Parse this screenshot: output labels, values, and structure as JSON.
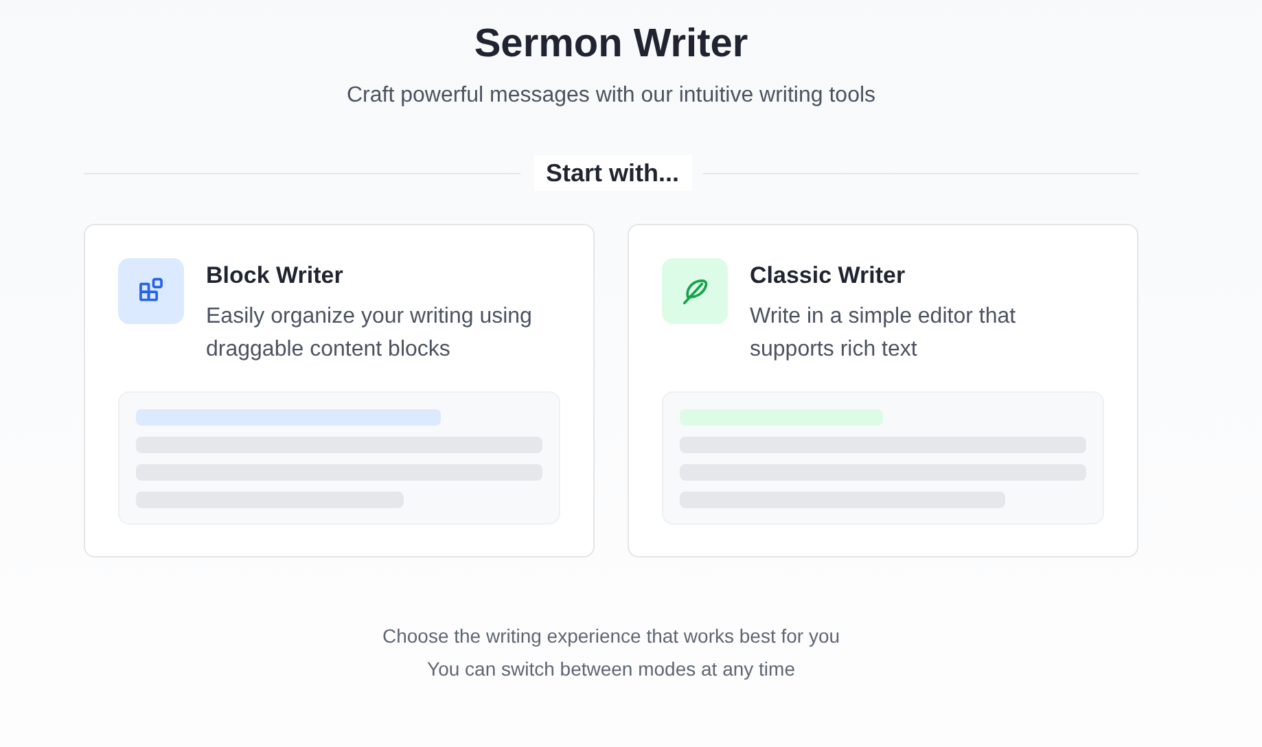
{
  "header": {
    "title": "Sermon Writer",
    "subtitle": "Craft powerful messages with our intuitive writing tools"
  },
  "section_label": "Start with...",
  "options": [
    {
      "kind": "block",
      "title": "Block Writer",
      "description": "Easily organize your writing using draggable content blocks"
    },
    {
      "kind": "classic",
      "title": "Classic Writer",
      "description": "Write in a simple editor that supports rich text"
    }
  ],
  "footer": [
    "Choose the writing experience that works best for you",
    "You can switch between modes at any time"
  ]
}
